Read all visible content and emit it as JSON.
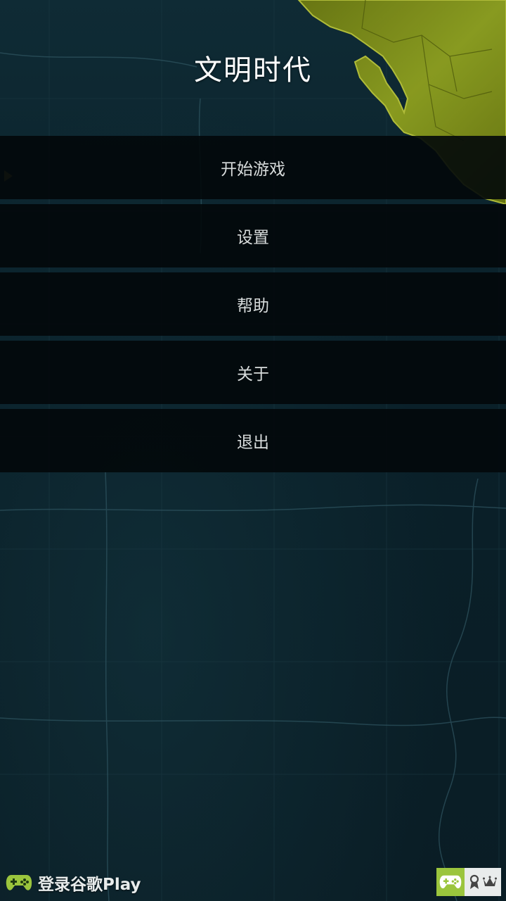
{
  "app": {
    "title": "文明时代"
  },
  "menu": {
    "items": [
      {
        "id": "start",
        "label": "开始游戏"
      },
      {
        "id": "settings",
        "label": "设置"
      },
      {
        "id": "help",
        "label": "帮助"
      },
      {
        "id": "about",
        "label": "关于"
      },
      {
        "id": "exit",
        "label": "退出"
      }
    ]
  },
  "footer": {
    "signin_label": "登录谷歌Play",
    "icons": {
      "signin": "gamepad-icon",
      "games": "gamepad-icon",
      "achievements": "achievement-ribbon-icon",
      "leaderboards": "crown-icon"
    }
  },
  "colors": {
    "ocean": "#0b1e26",
    "land": "#8a9a1c",
    "menu_bg": "#02080a",
    "play_games_green": "#9bc53d"
  }
}
